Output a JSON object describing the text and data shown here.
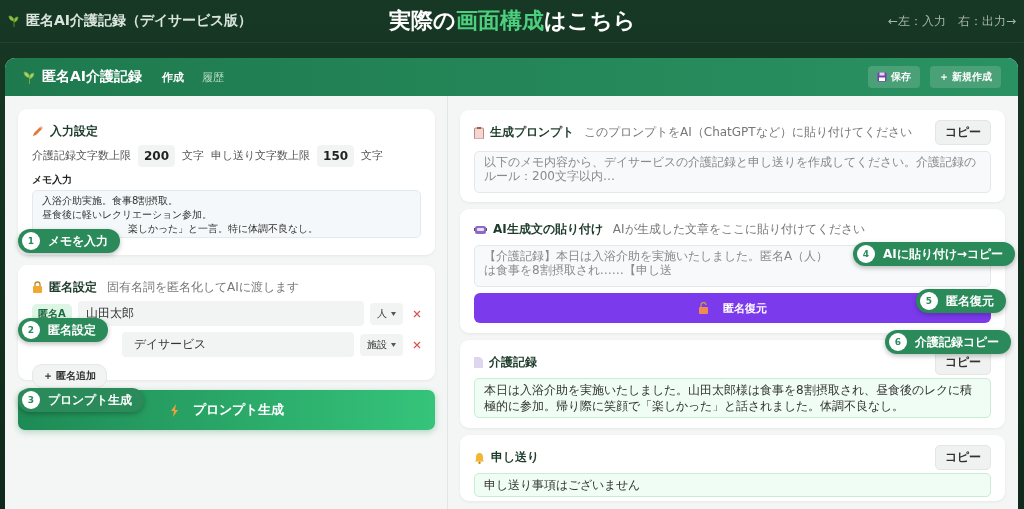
{
  "banner": {
    "title": "匿名AI介護記録（デイサービス版）",
    "headline": [
      {
        "text": "実際の",
        "highlight": false
      },
      {
        "text": "画面構成",
        "highlight": true
      },
      {
        "text": "はこちら",
        "highlight": false
      }
    ],
    "hints": [
      "←左：入力",
      "右：出力→"
    ]
  },
  "app": {
    "title": "匿名AI介護記録",
    "tabs": [
      {
        "label": "作成",
        "selected": true
      },
      {
        "label": "履歴",
        "selected": false
      }
    ],
    "save": "保存",
    "new": "＋ 新規作成"
  },
  "input_settings": {
    "title": "入力設定",
    "limits": [
      {
        "label": "介護記録文字数上限",
        "value": "200",
        "unit": "文字"
      },
      {
        "label": "申し送り文字数上限",
        "value": "150",
        "unit": "文字"
      }
    ],
    "memo_label": "メモ入力",
    "memo_lines": [
      "入浴介助実施。食事8割摂取。",
      "昼食後に軽いレクリエーション参加。",
      "楽しかった」と一言。特に体調不良なし。"
    ]
  },
  "anonymize": {
    "title": "匿名設定",
    "note": "固有名詞を匿名化してAIに渡します",
    "rows": [
      {
        "tag": "匿名A",
        "name": "山田太郎",
        "type": "人"
      },
      {
        "name": "デイサービス",
        "type": "施設"
      }
    ],
    "add": "＋ 匿名追加"
  },
  "generate_button": "プロンプト生成",
  "prompt": {
    "title": "生成プロンプト",
    "note": "このプロンプトをAI（ChatGPTなど）に貼り付けてください",
    "copy": "コピー",
    "placeholder": "以下のメモ内容から、デイサービスの介護記録と申し送りを作成してください。介護記録のルール：200文字以内…"
  },
  "paste": {
    "title": "AI生成文の貼り付け",
    "note": "AIが生成した文章をここに貼り付けてください",
    "placeholder": "【介護記録】本日は入浴介助を実施いたしました。匿名A（人）は食事を8割摂取され……【申し送",
    "restore": "匿名復元"
  },
  "record": {
    "title": "介護記録",
    "copy": "コピー",
    "text": "本日は入浴介助を実施いたしました。山田太郎様は食事を8割摂取され、昼食後のレクに積極的に参加。帰り際に笑顔で「楽しかった」と話されました。体調不良なし。"
  },
  "handover": {
    "title": "申し送り",
    "copy": "コピー",
    "text": "申し送り事項はございません"
  },
  "callouts": [
    {
      "number": "1",
      "label": "メモを入力"
    },
    {
      "number": "2",
      "label": "匿名設定"
    },
    {
      "number": "3",
      "label": "プロンプト生成"
    },
    {
      "number": "4",
      "label": "AIに貼り付け→コピー"
    },
    {
      "number": "5",
      "label": "匿名復元"
    },
    {
      "number": "6",
      "label": "介護記録コピー"
    }
  ]
}
